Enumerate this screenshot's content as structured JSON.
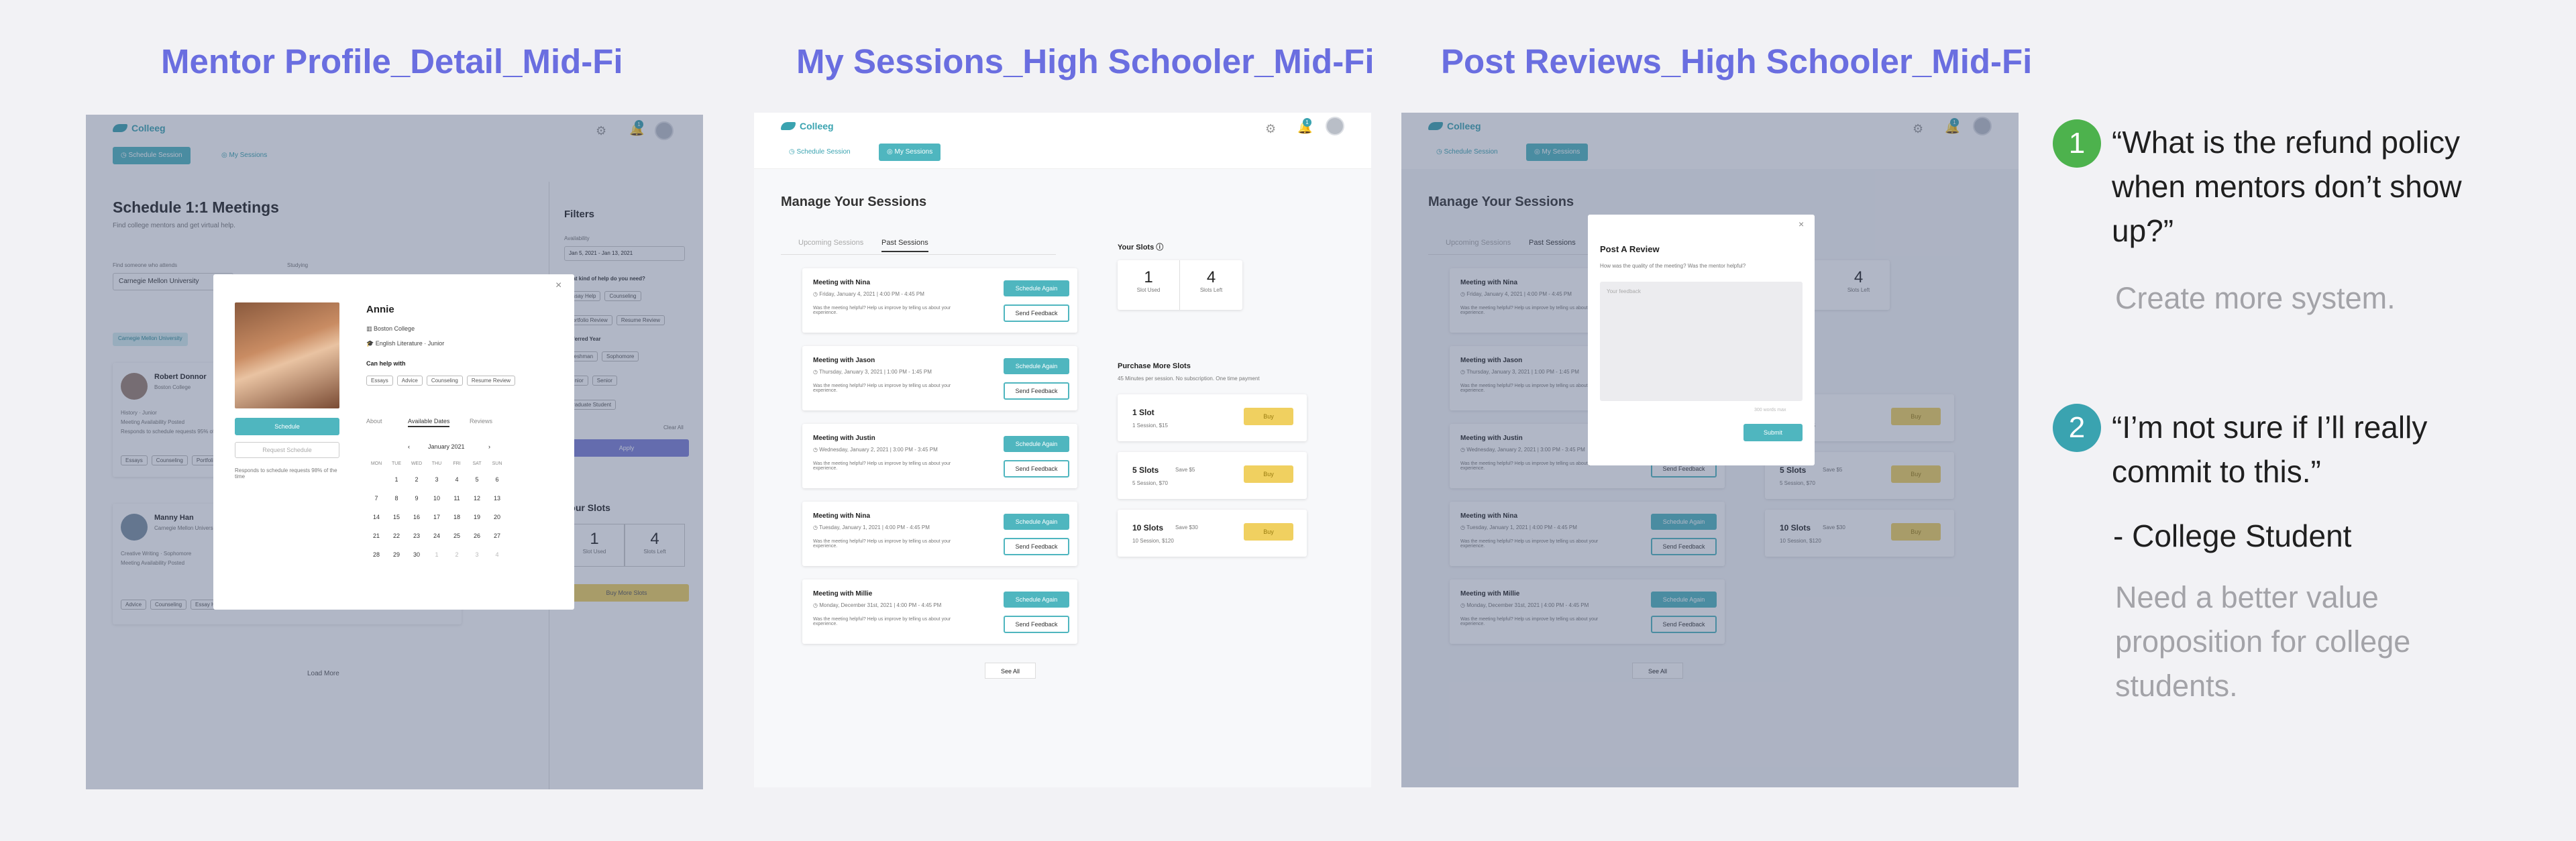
{
  "titles": {
    "mentor": "Mentor Profile_Detail_Mid-Fi",
    "sessions": "My Sessions_High Schooler_Mid-Fi",
    "reviews": "Post Reviews_High Schooler_Mid-Fi"
  },
  "app": {
    "logo": "Colleeg",
    "nav_schedule": "Schedule Session",
    "nav_sessions": "My Sessions",
    "notif_count": "1"
  },
  "mentor_screen": {
    "heading": "Schedule 1:1 Meetings",
    "subheading": "Find college mentors and get virtual help.",
    "find_label": "Find someone who attends",
    "find_value": "Carnegie Mellon University",
    "studying_label": "Studying",
    "filter_chip": "Carnegie Mellon University",
    "filters_title": "Filters",
    "availability_label": "Availability",
    "availability_value": "Jan 5, 2021 - Jan 13, 2021",
    "help_label": "What kind of help do you need?",
    "help_options": [
      "Essay Help",
      "Counseling",
      "Portfolio Review",
      "Resume Review"
    ],
    "preferred_year": "Preferred Year",
    "year_options": [
      "Freshman",
      "Sophomore",
      "Junior",
      "Senior",
      "Graduate Student"
    ],
    "clear_all": "Clear All",
    "apply": "Apply",
    "your_slots": "Your Slots",
    "slot_used": "1",
    "slot_used_label": "Slot Used",
    "slots_left": "4",
    "slots_left_label": "Slots Left",
    "buy_more": "Buy More Slots",
    "load_more": "Load More",
    "list_mentors": [
      {
        "name": "Robert Donnor",
        "school": "Boston College",
        "lines": [
          "History · Junior",
          "Meeting Availability Posted",
          "Responds to schedule requests 95% of the time"
        ],
        "tags": [
          "Essays",
          "Counseling",
          "Portfolio"
        ]
      },
      {
        "name": "Manny Han",
        "school": "Carnegie Mellon University",
        "lines": [
          "Creative Writing · Sophomore",
          "Meeting Availability Posted"
        ],
        "tags": [
          "Advice",
          "Counseling",
          "Essay Help"
        ]
      }
    ],
    "modal": {
      "name": "Annie",
      "school": "Boston College",
      "major": "English Literature · Junior",
      "can_help": "Can help with",
      "tags": [
        "Essays",
        "Advice",
        "Counseling",
        "Resume Review"
      ],
      "tabs": [
        "About",
        "Available Dates",
        "Reviews"
      ],
      "schedule": "Schedule",
      "request": "Request Schedule",
      "responds": "Responds to schedule requests 98% of the time",
      "month": "January 2021",
      "weekdays": [
        "MON",
        "TUE",
        "WED",
        "THU",
        "FRI",
        "SAT",
        "SUN"
      ],
      "weeks": [
        [
          "",
          "1",
          "2",
          "3",
          "4",
          "5",
          "6"
        ],
        [
          "7",
          "8",
          "9",
          "10",
          "11",
          "12",
          "13"
        ],
        [
          "14",
          "15",
          "16",
          "17",
          "18",
          "19",
          "20"
        ],
        [
          "21",
          "22",
          "23",
          "24",
          "25",
          "26",
          "27"
        ],
        [
          "28",
          "29",
          "30",
          "1",
          "2",
          "3",
          "4"
        ]
      ]
    }
  },
  "sessions_screen": {
    "heading": "Manage Your Sessions",
    "tab_upcoming": "Upcoming Sessions",
    "tab_past": "Past Sessions",
    "feedback_prompt": "Was the meeting helpful? Help us improve by telling us about your experience.",
    "schedule_again": "Schedule Again",
    "send_feedback": "Send Feedback",
    "see_all": "See All",
    "meetings": [
      {
        "title": "Meeting with Nina",
        "date": "Friday, January 4, 2021 | 4:00 PM - 4:45 PM"
      },
      {
        "title": "Meeting with Jason",
        "date": "Thursday, January 3, 2021 | 1:00 PM - 1:45 PM"
      },
      {
        "title": "Meeting with Justin",
        "date": "Wednesday, January 2, 2021 | 3:00 PM - 3:45 PM"
      },
      {
        "title": "Meeting with Nina",
        "date": "Tuesday, January 1, 2021 | 4:00 PM - 4:45 PM"
      },
      {
        "title": "Meeting with Millie",
        "date": "Monday, December 31st, 2021 | 4:00 PM - 4:45 PM"
      }
    ],
    "your_slots": "Your Slots",
    "slot_used": "1",
    "slot_used_label": "Slot Used",
    "slots_left": "4",
    "slots_left_label": "Slots Left",
    "purchase_title": "Purchase More Slots",
    "purchase_sub": "45 Minutes per session. No subscription. One time payment",
    "buy": "Buy",
    "packages": [
      {
        "name": "1 Slot",
        "save": "",
        "price": "1 Session, $15"
      },
      {
        "name": "5 Slots",
        "save": "Save $5",
        "price": "5 Session, $70"
      },
      {
        "name": "10 Slots",
        "save": "Save $30",
        "price": "10 Session, $120"
      }
    ]
  },
  "review_modal": {
    "title": "Post A Review",
    "question": "How was the quality of the meeting? Was the mentor helpful?",
    "placeholder": "Your feedback",
    "counter": "300 words max",
    "submit": "Submit"
  },
  "insights": [
    {
      "number": "1",
      "quote": "“What is the refund policy when mentors don’t show up?”",
      "note": "Create more system.",
      "color": "#4db24d"
    },
    {
      "number": "2",
      "quote": "“I’m not sure if I’ll really commit to this.”",
      "attribution": "- College Student",
      "note": "Need a better value proposition for college students.",
      "color": "#3aa3b0"
    }
  ]
}
